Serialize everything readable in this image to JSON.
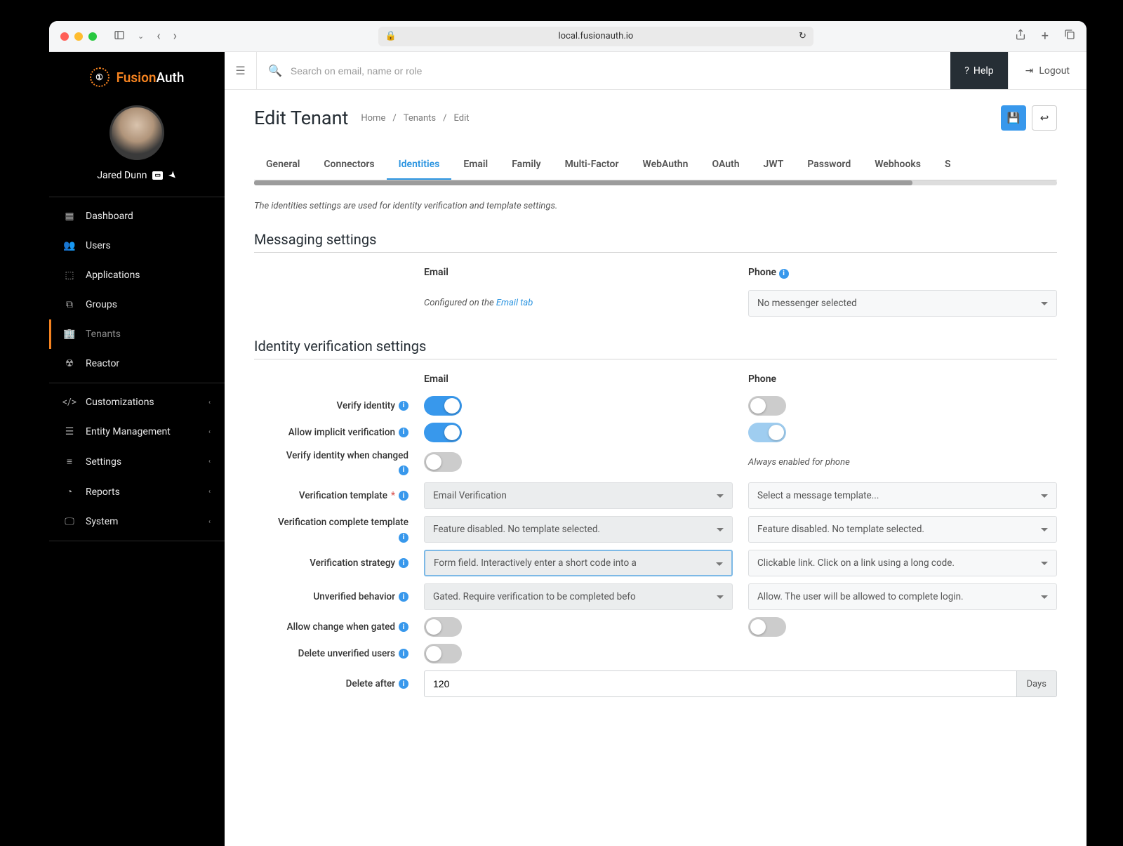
{
  "browser": {
    "url": "local.fusionauth.io"
  },
  "brand": {
    "name_a": "Fusion",
    "name_b": "Auth"
  },
  "user": {
    "name": "Jared Dunn"
  },
  "sidebar": {
    "main": [
      {
        "label": "Dashboard",
        "icon": "dashboard"
      },
      {
        "label": "Users",
        "icon": "users"
      },
      {
        "label": "Applications",
        "icon": "apps"
      },
      {
        "label": "Groups",
        "icon": "groups"
      },
      {
        "label": "Tenants",
        "icon": "tenants",
        "active": true
      },
      {
        "label": "Reactor",
        "icon": "reactor"
      }
    ],
    "secondary": [
      {
        "label": "Customizations",
        "icon": "code"
      },
      {
        "label": "Entity Management",
        "icon": "entity"
      },
      {
        "label": "Settings",
        "icon": "settings"
      },
      {
        "label": "Reports",
        "icon": "reports"
      },
      {
        "label": "System",
        "icon": "system"
      }
    ]
  },
  "topbar": {
    "search_placeholder": "Search on email, name or role",
    "help": "Help",
    "logout": "Logout"
  },
  "page": {
    "title": "Edit Tenant",
    "breadcrumbs": [
      "Home",
      "Tenants",
      "Edit"
    ]
  },
  "tabs": [
    "General",
    "Connectors",
    "Identities",
    "Email",
    "Family",
    "Multi-Factor",
    "WebAuthn",
    "OAuth",
    "JWT",
    "Password",
    "Webhooks",
    "S"
  ],
  "active_tab": "Identities",
  "content": {
    "description": "The identities settings are used for identity verification and template settings.",
    "messaging": {
      "title": "Messaging settings",
      "col_email": "Email",
      "col_phone": "Phone",
      "email_note_prefix": "Configured on the ",
      "email_note_link": "Email tab",
      "phone_select": "No messenger selected"
    },
    "identity": {
      "title": "Identity verification settings",
      "col_email": "Email",
      "col_phone": "Phone",
      "rows": {
        "verify_identity": "Verify identity",
        "allow_implicit": "Allow implicit verification",
        "verify_changed": "Verify identity when changed",
        "verify_changed_phone_note": "Always enabled for phone",
        "verification_template": "Verification template",
        "verification_template_email": "Email Verification",
        "verification_template_phone": "Select a message template...",
        "verification_complete": "Verification complete template",
        "verification_complete_val": "Feature disabled. No template selected.",
        "verification_strategy": "Verification strategy",
        "verification_strategy_email": "Form field. Interactively enter a short code into a",
        "verification_strategy_phone": "Clickable link. Click on a link using a long code.",
        "unverified_behavior": "Unverified behavior",
        "unverified_behavior_email": "Gated. Require verification to be completed befo",
        "unverified_behavior_phone": "Allow. The user will be allowed to complete login.",
        "allow_change_gated": "Allow change when gated",
        "delete_unverified": "Delete unverified users",
        "delete_after": "Delete after",
        "delete_after_value": "120",
        "delete_after_unit": "Days"
      }
    }
  }
}
